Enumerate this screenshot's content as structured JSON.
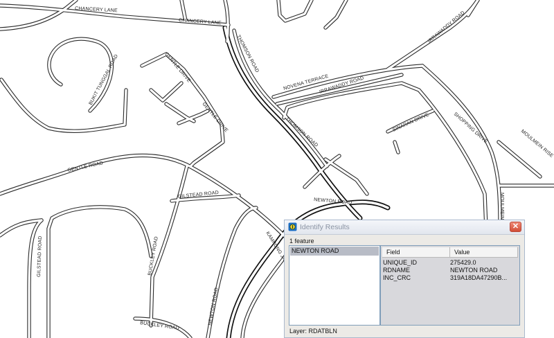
{
  "map": {
    "labels": {
      "chancery_lane_1": "CHANCERY LANE",
      "chancery_lane_2": "CHANCERY LANE",
      "thomson_road_1": "THOMSON ROAD",
      "thomson_road_2": "THOMSON ROAD",
      "irrawaddy_road_1": "IRRAWADDY ROAD",
      "irrawaddy_road_2": "IRRAWADDY ROAD",
      "novena_terrace": "NOVENA TERRACE",
      "bukit_tunggal_road": "BUKIT TUNGGAL ROAD",
      "gentle_drive_1": "GENTLE DRIVE",
      "gentle_drive_2": "GENTLE DRIVE",
      "gentle_road": "GENTLE ROAD",
      "gilstead_road_1": "GILSTEAD ROAD",
      "gilstead_road_2": "GILSTEAD ROAD",
      "buckley_road_1": "BUCKLEY ROAD",
      "buckley_road_2": "BUCKLEY ROAD",
      "newton_road_1": "NEWTON ROAD",
      "newton_road_2": "NEWTON ROAD",
      "kampong_java": "KAMPONG JAVA",
      "sinaran_drive": "SINARAN DRIVE",
      "shopping_drive": "SHOPPING DRIVE",
      "moulmein_rise": "MOULMEIN RISE",
      "moulmein": "MOULMEIN"
    }
  },
  "dialog": {
    "title": "Identify Results",
    "close_glyph": "✕",
    "feature_count": "1 feature",
    "features": [
      "NEWTON ROAD"
    ],
    "columns": {
      "field": "Field",
      "value": "Value"
    },
    "rows": [
      {
        "field": "UNIQUE_ID",
        "value": "275429.0"
      },
      {
        "field": "RDNAME",
        "value": "NEWTON ROAD"
      },
      {
        "field": "INC_CRC",
        "value": "319A18DA47290B..."
      }
    ],
    "layer": "Layer: RDATBLN"
  }
}
